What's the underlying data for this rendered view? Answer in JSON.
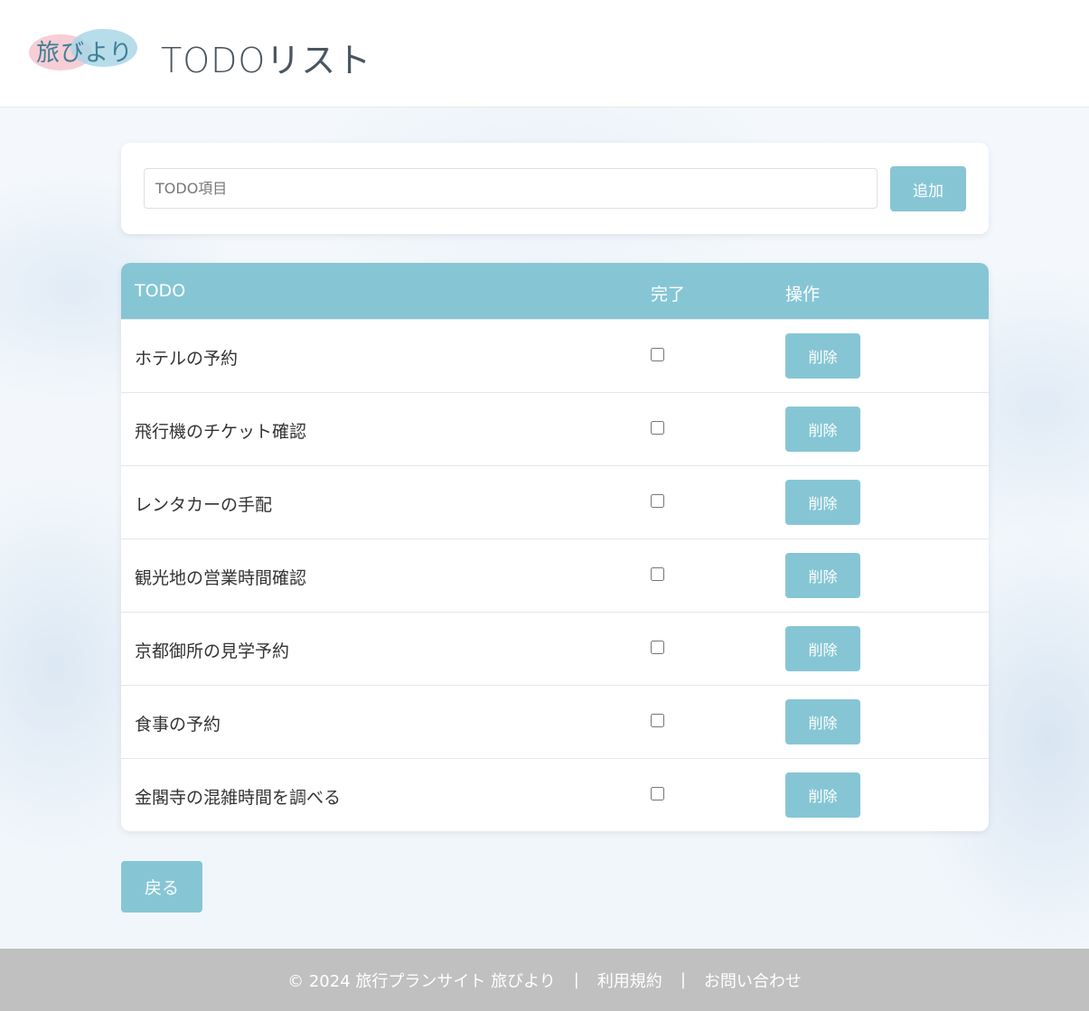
{
  "header": {
    "logo_text": "旅びより",
    "title": "TODOリスト"
  },
  "add_form": {
    "placeholder": "TODO項目",
    "value": "",
    "add_label": "追加"
  },
  "table": {
    "columns": [
      "TODO",
      "完了",
      "操作"
    ],
    "delete_label": "削除",
    "rows": [
      {
        "text": "ホテルの予約",
        "done": false
      },
      {
        "text": "飛行機のチケット確認",
        "done": false
      },
      {
        "text": "レンタカーの手配",
        "done": false
      },
      {
        "text": "観光地の営業時間確認",
        "done": false
      },
      {
        "text": "京都御所の見学予約",
        "done": false
      },
      {
        "text": "食事の予約",
        "done": false
      },
      {
        "text": "金閣寺の混雑時間を調べる",
        "done": false
      }
    ]
  },
  "back_label": "戻る",
  "footer": {
    "copyright": "© 2024 旅行プランサイト 旅びより",
    "separator": "|",
    "links": [
      "利用規約",
      "お問い合わせ"
    ]
  },
  "colors": {
    "accent": "#86c6d4",
    "footer_bg": "#c0c0c0",
    "logo_pink": "#f6c4cf",
    "logo_blue": "#aad6e6"
  }
}
